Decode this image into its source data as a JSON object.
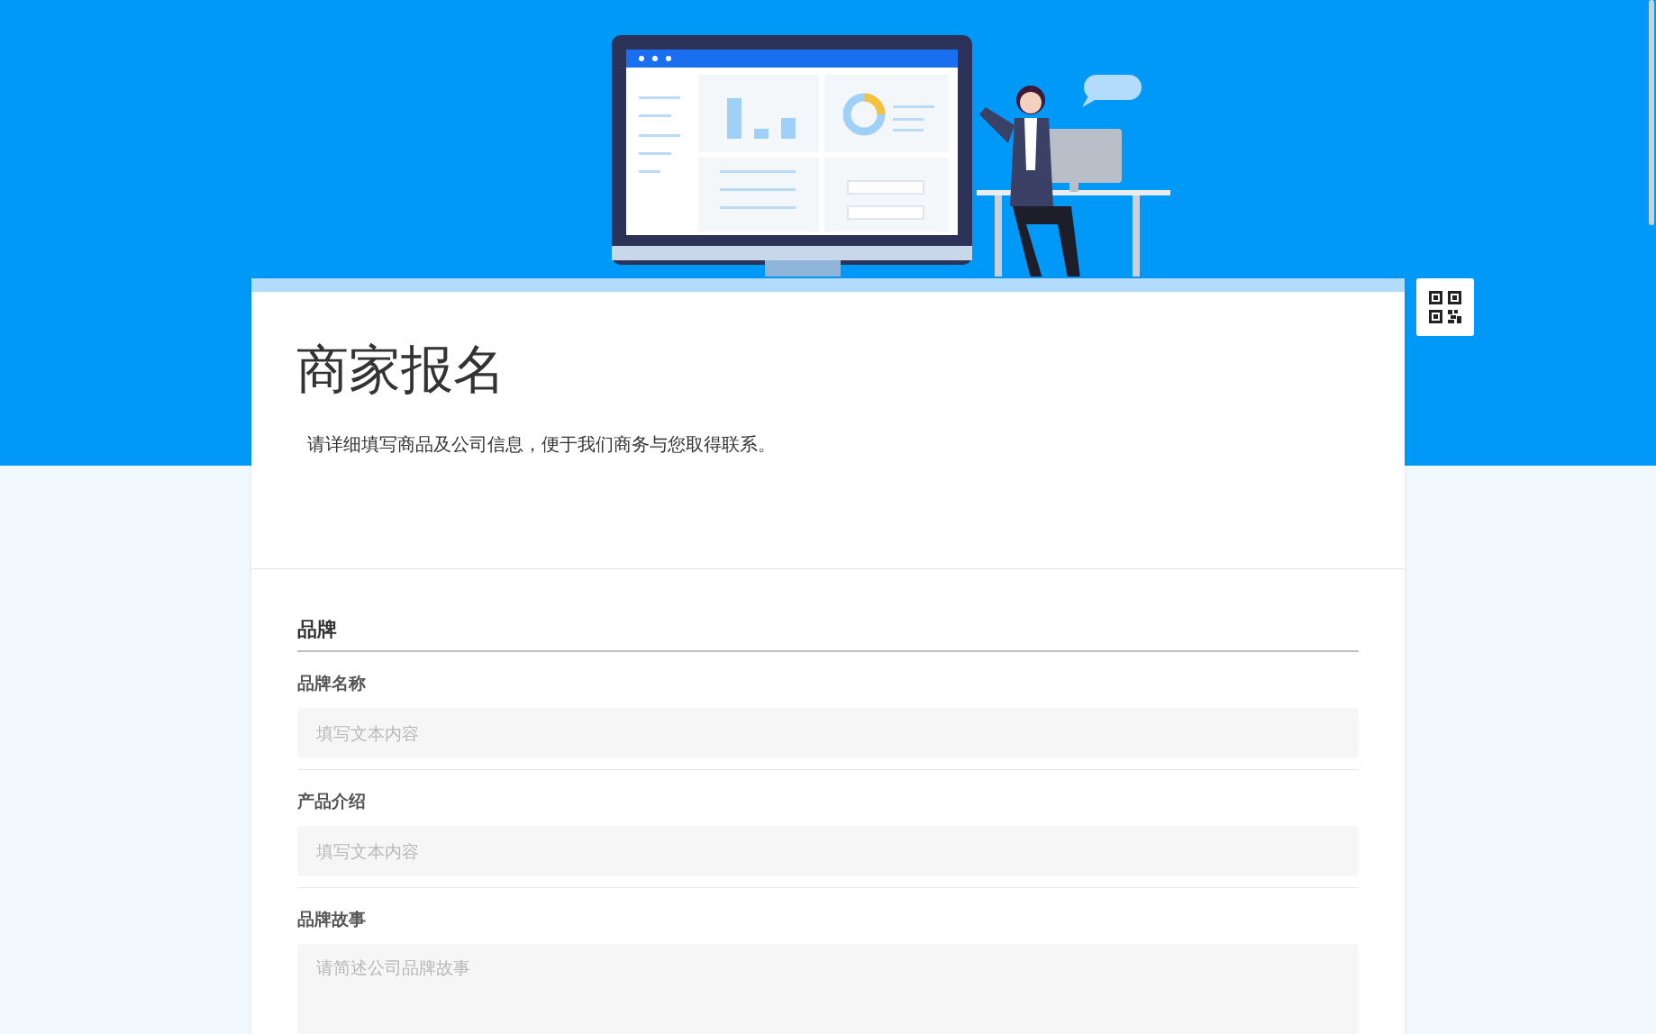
{
  "form": {
    "title": "商家报名",
    "description": "请详细填写商品及公司信息，便于我们商务与您取得联系。",
    "sections": [
      {
        "title": "品牌",
        "fields": [
          {
            "label": "品牌名称",
            "placeholder": "填写文本内容",
            "kind": "text"
          },
          {
            "label": "产品介绍",
            "placeholder": "填写文本内容",
            "kind": "text"
          },
          {
            "label": "品牌故事",
            "placeholder": "请简述公司品牌故事",
            "kind": "textarea"
          }
        ]
      }
    ]
  }
}
